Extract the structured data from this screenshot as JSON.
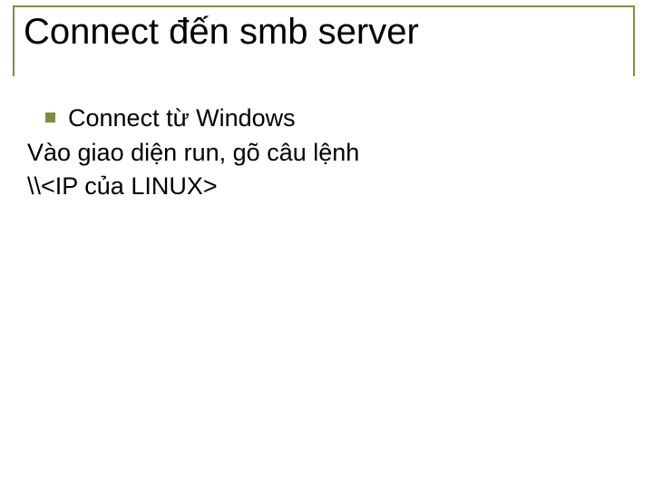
{
  "slide": {
    "title": "Connect đến smb server",
    "bullet1": "Connect từ Windows",
    "line2": "Vào giao diện run, gõ câu lệnh",
    "line3": "\\\\<IP của LINUX>"
  }
}
